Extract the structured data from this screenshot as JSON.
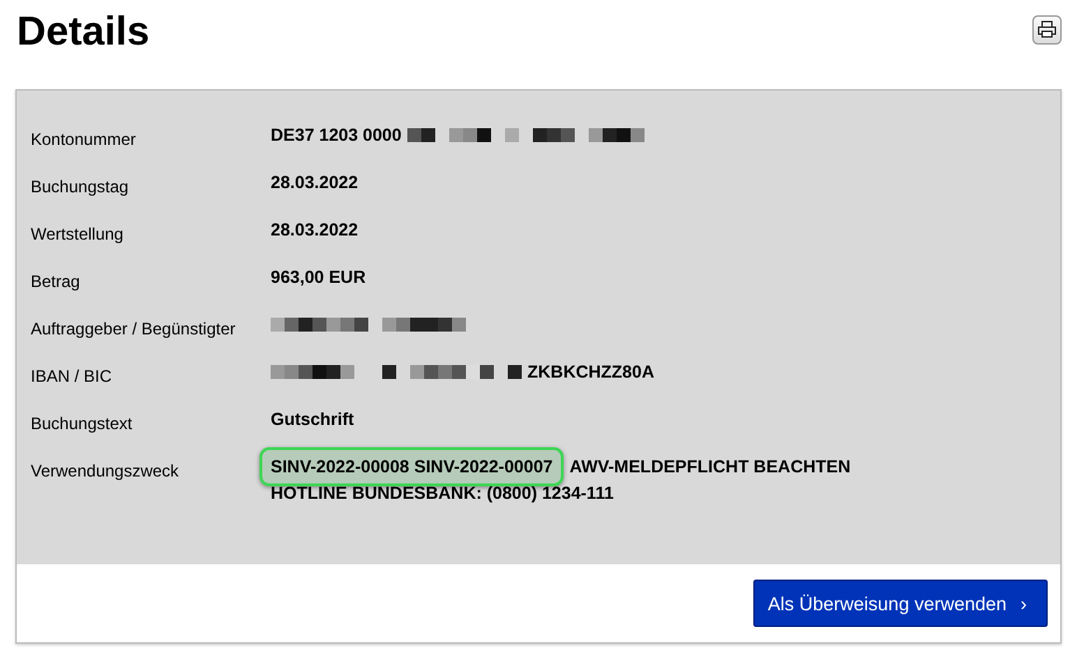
{
  "title": "Details",
  "rows": [
    {
      "label": "Kontonummer",
      "lines": [
        [
          {
            "kind": "text",
            "text": "DE37 1203 0000"
          },
          {
            "kind": "redacted"
          }
        ]
      ]
    },
    {
      "label": "Buchungstag",
      "lines": [
        [
          {
            "kind": "text",
            "text": "28.03.2022"
          }
        ]
      ]
    },
    {
      "label": "Wertstellung",
      "lines": [
        [
          {
            "kind": "text",
            "text": "28.03.2022"
          }
        ]
      ]
    },
    {
      "label": "Betrag",
      "lines": [
        [
          {
            "kind": "text",
            "text": "963,00 EUR"
          }
        ]
      ]
    },
    {
      "label": "Auftraggeber / Begünstigter",
      "lines": [
        [
          {
            "kind": "redacted"
          }
        ]
      ]
    },
    {
      "label": "IBAN / BIC",
      "lines": [
        [
          {
            "kind": "redacted"
          },
          {
            "kind": "text",
            "text": "ZKBKCHZZ80A"
          }
        ]
      ]
    },
    {
      "label": "Buchungstext",
      "lines": [
        [
          {
            "kind": "text",
            "text": "Gutschrift"
          }
        ]
      ]
    },
    {
      "label": "Verwendungszweck",
      "lines": [
        [
          {
            "kind": "text",
            "text": "SINV-2022-00008 SINV-2022-00007",
            "highlighted": true
          },
          {
            "kind": "text",
            "text": "AWV-MELDEPFLICHT BEACHTEN"
          }
        ],
        [
          {
            "kind": "text",
            "text": "HOTLINE BUNDESBANK: (0800) 1234-111"
          }
        ]
      ]
    }
  ],
  "button": {
    "label": "Als Überweisung verwenden",
    "arrow": "›"
  }
}
